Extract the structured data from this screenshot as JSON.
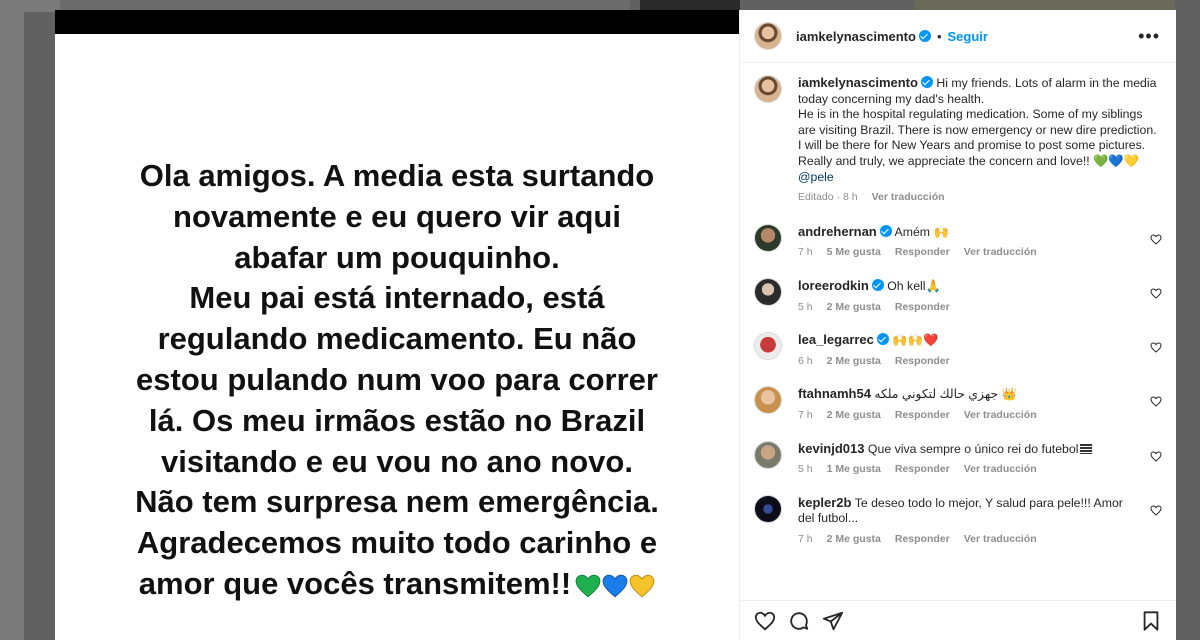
{
  "post": {
    "media_text": "Ola amigos. A media esta surtando\nnovamente e eu quero vir aqui\nabafar um pouquinho.\nMeu pai está internado, está\nregulando medicamento. Eu não\nestou pulando num voo para correr\nlá. Os meu irmãos estão no Brazil\nvisitando e eu vou no ano novo.\nNão tem surpresa nem emergência.\nAgradecemos muito todo carinho e\namor que vocês transmitem!!",
    "media_hearts": [
      "green-heart-icon",
      "blue-heart-icon",
      "yellow-heart-icon"
    ]
  },
  "header": {
    "username": "iamkelynascimento",
    "dot": "•",
    "follow_label": "Seguir",
    "more_icon": "more-options-icon"
  },
  "caption": {
    "username": "iamkelynascimento",
    "text": "Hi my friends. Lots of alarm in the media today concerning my dad's health.\nHe is in the hospital regulating medication. Some of my siblings are visiting Brazil. There is now emergency or new dire prediction. I will be there for New Years and promise to post some pictures.\nReally and truly, we appreciate the concern and love!! ",
    "hearts": "💚💙💛",
    "mention": "@pele",
    "edited": "Editado",
    "time": "8 h",
    "translate": "Ver traducción"
  },
  "comments": [
    {
      "username": "andrehernan",
      "verified": true,
      "text": "Amém 🙌",
      "time": "7 h",
      "likes": "5 Me gusta",
      "reply": "Responder",
      "translate": "Ver traducción"
    },
    {
      "username": "loreerodkin",
      "verified": true,
      "text": "Oh kell🙏",
      "time": "5 h",
      "likes": "2 Me gusta",
      "reply": "Responder",
      "translate": ""
    },
    {
      "username": "lea_legarrec",
      "verified": true,
      "text": "🙌🙌❤️",
      "time": "6 h",
      "likes": "2 Me gusta",
      "reply": "Responder",
      "translate": ""
    },
    {
      "username": "ftahnamh54",
      "verified": false,
      "text": "جهزي حالك لتكوني ملكه 👑",
      "time": "7 h",
      "likes": "2 Me gusta",
      "reply": "Responder",
      "translate": "Ver traducción"
    },
    {
      "username": "kevinjd013",
      "verified": false,
      "text": "Que viva sempre o único rei do futebol",
      "time": "5 h",
      "likes": "1 Me gusta",
      "reply": "Responder",
      "translate": "Ver traducción"
    },
    {
      "username": "kepler2b",
      "verified": false,
      "text": "Te deseo todo lo mejor, Y salud para pele!!! Amor del futbol...",
      "time": "7 h",
      "likes": "2 Me gusta",
      "reply": "Responder",
      "translate": "Ver traducción"
    }
  ],
  "footer": {
    "icons": [
      "like-icon",
      "comment-icon",
      "share-icon",
      "save-icon"
    ]
  },
  "colors": {
    "accent": "#0095f6",
    "muted": "#8e8e8e",
    "text": "#262626"
  }
}
